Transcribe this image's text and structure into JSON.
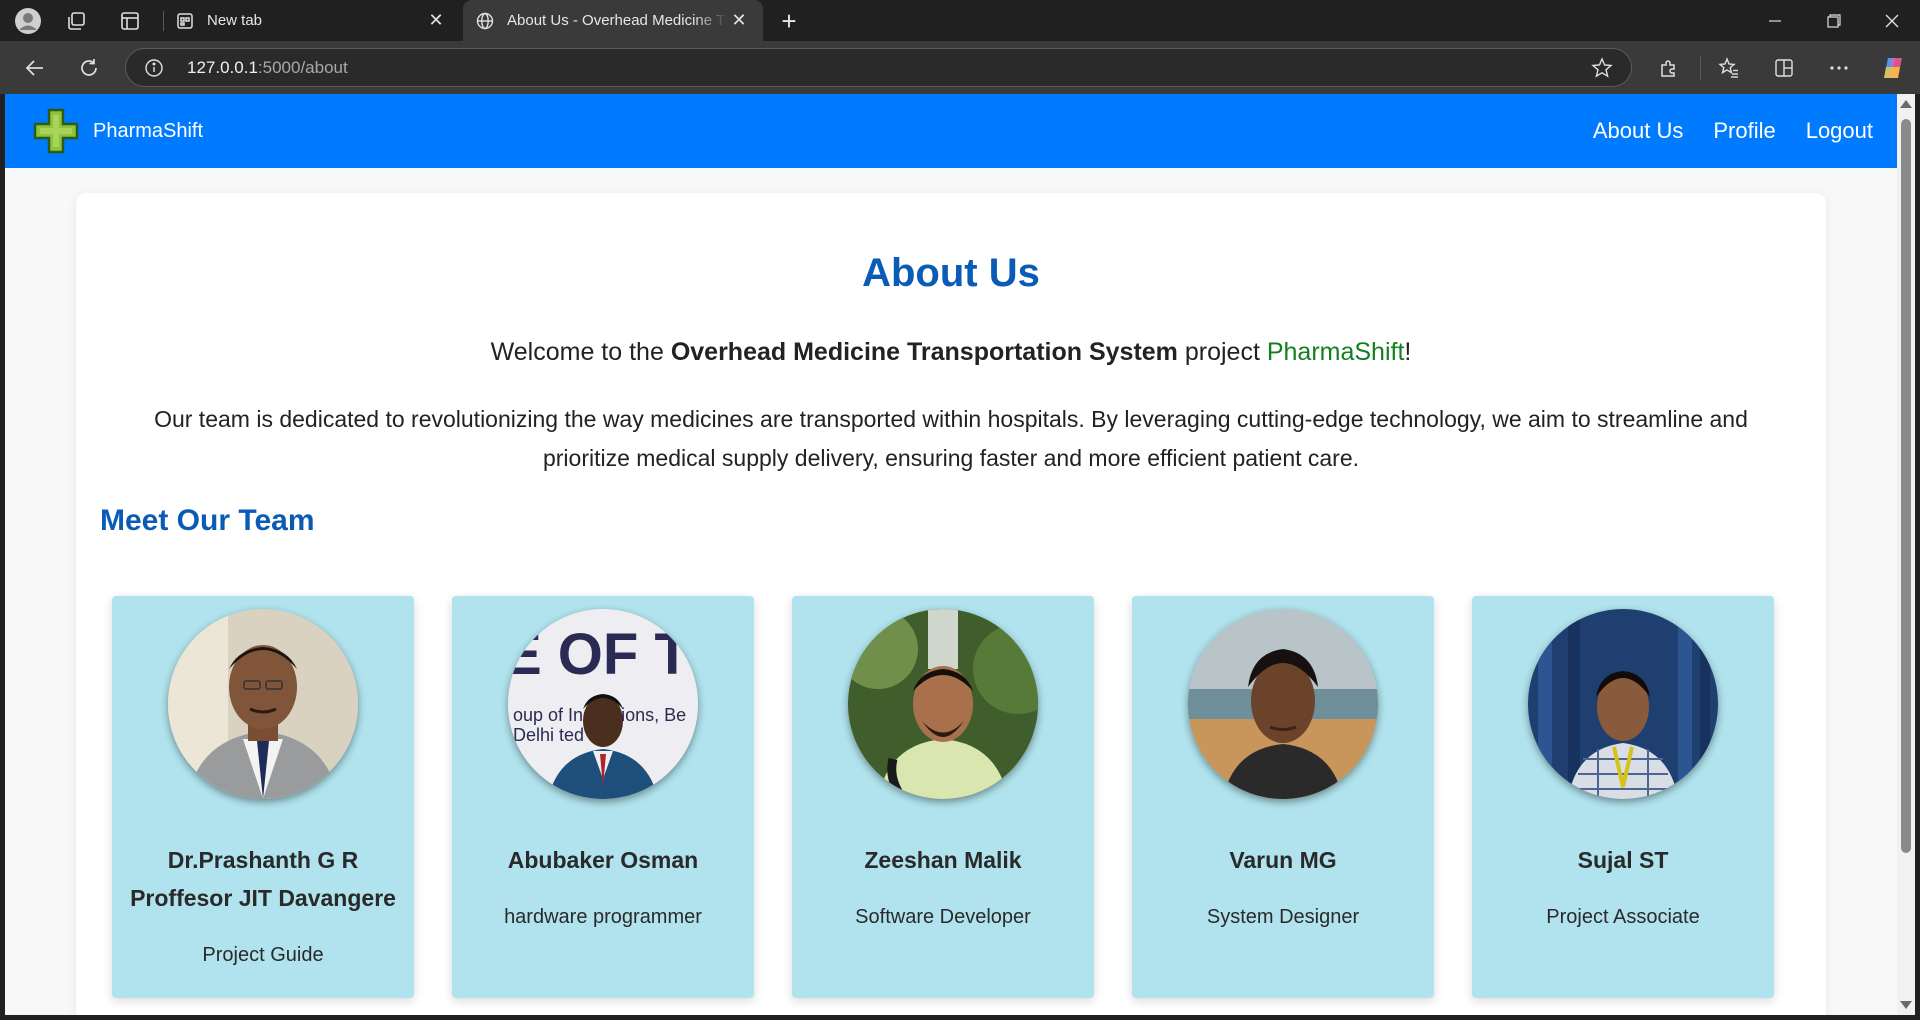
{
  "browser": {
    "tabs": [
      {
        "title": "New tab",
        "active": false
      },
      {
        "title": "About Us - Overhead Medicine Transportation System",
        "active": true
      }
    ],
    "address": {
      "host": "127.0.0.1",
      "path": ":5000/about"
    }
  },
  "site": {
    "brand": "PharmaShift",
    "nav": [
      "About Us",
      "Profile",
      "Logout"
    ]
  },
  "page": {
    "title": "About Us",
    "welcome": {
      "prefix": "Welcome to the ",
      "strong": "Overhead Medicine Transportation System",
      "middle": " project ",
      "brand": "PharmaShift",
      "suffix": "!"
    },
    "mission": "Our team is dedicated to revolutionizing the way medicines are transported within hospitals. By leveraging cutting-edge technology, we aim to streamline and prioritize medical supply delivery, ensuring faster and more efficient patient care.",
    "team_title": "Meet Our Team",
    "team": [
      {
        "name": "Dr.Prashanth G R",
        "name2": "Proffesor JIT Davangere",
        "role": "Project Guide"
      },
      {
        "name": "Abubaker Osman",
        "role": "hardware programmer"
      },
      {
        "name": "Zeeshan Malik",
        "role": "Software Developer"
      },
      {
        "name": "Varun MG",
        "role": "System Designer"
      },
      {
        "name": "Sujal ST",
        "role": "Project Associate"
      }
    ]
  },
  "colors": {
    "navbar": "#007bff",
    "heading": "#0a5bb5",
    "brand_text": "#12801f",
    "card_bg": "#b0e3ed"
  }
}
